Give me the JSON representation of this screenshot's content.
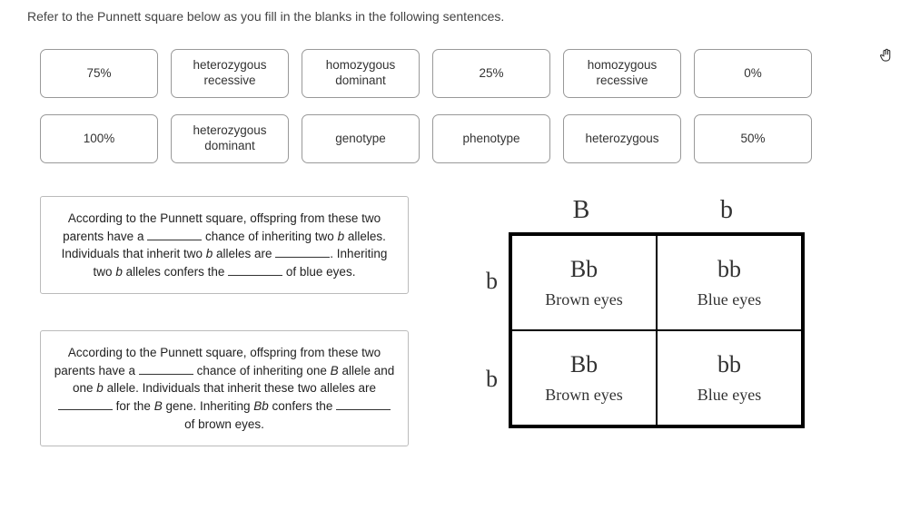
{
  "instruction": "Refer to the Punnett square below as you fill in the blanks in the following sentences.",
  "tiles_row1": [
    "75%",
    "heterozygous recessive",
    "homozygous dominant",
    "25%",
    "homozygous recessive",
    "0%"
  ],
  "tiles_row2": [
    "100%",
    "heterozygous dominant",
    "genotype",
    "phenotype",
    "heterozygous",
    "50%"
  ],
  "para1": {
    "t1": "According to the Punnett square, offspring from these two parents have a ",
    "t2": " chance of inheriting two ",
    "t2b": "b",
    "t3": " alleles. Individuals that inherit two ",
    "t3b": "b",
    "t4": " alleles are ",
    "t5": ". Inheriting two ",
    "t5b": "b",
    "t6": " alleles confers the ",
    "t7": " of blue eyes."
  },
  "para2": {
    "t1": "According to the Punnett square, offspring from these two parents have a ",
    "t2": " chance of inheriting one ",
    "t2b": "B",
    "t3": " allele and one ",
    "t3b": "b",
    "t4": " allele. Individuals that inherit these two alleles are ",
    "t5": " for the ",
    "t5b": "B",
    "t6": " gene. Inheriting ",
    "t6b": "Bb",
    "t7": " confers the ",
    "t8": " of brown eyes."
  },
  "punnett": {
    "top": [
      "B",
      "b"
    ],
    "side": [
      "b",
      "b"
    ],
    "cells": [
      {
        "geno": "Bb",
        "pheno": "Brown eyes"
      },
      {
        "geno": "bb",
        "pheno": "Blue eyes"
      },
      {
        "geno": "Bb",
        "pheno": "Brown eyes"
      },
      {
        "geno": "bb",
        "pheno": "Blue eyes"
      }
    ]
  },
  "hand_icon": "✋"
}
